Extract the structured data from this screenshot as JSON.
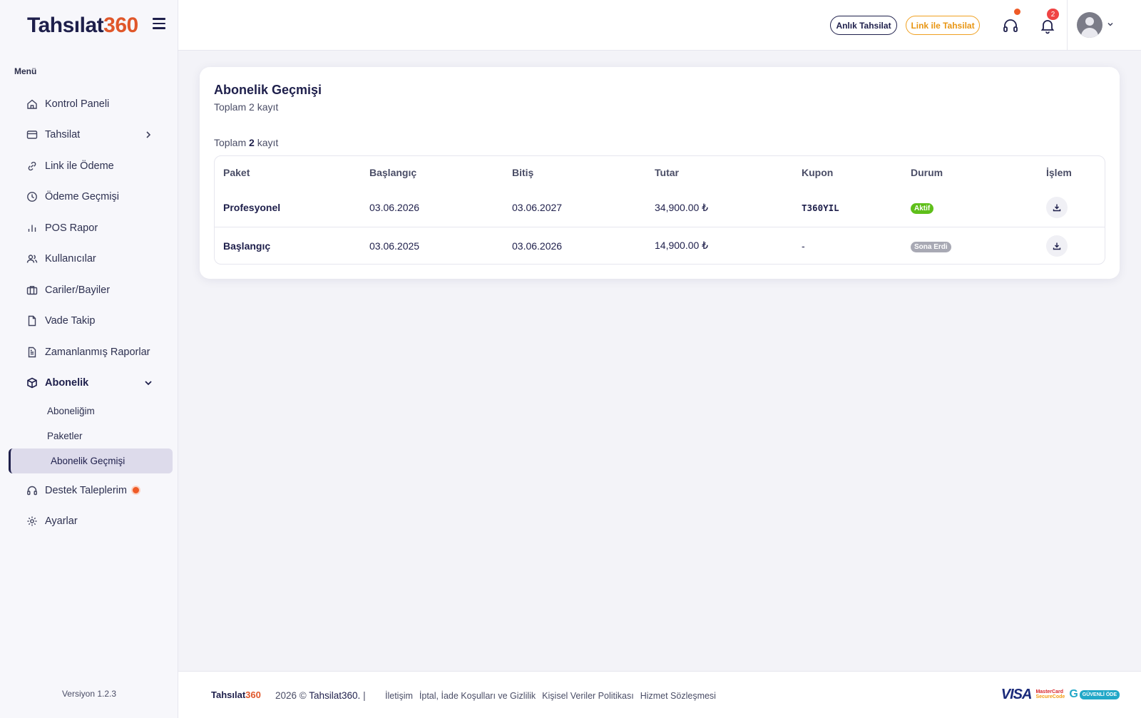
{
  "brand": {
    "logo_main": "Tahsılat",
    "logo_accent": "360"
  },
  "sidebar": {
    "menu_label": "Menü",
    "items": [
      {
        "label": "Kontrol Paneli",
        "icon": "home-icon"
      },
      {
        "label": "Tahsilat",
        "icon": "card-icon"
      },
      {
        "label": "Link ile Ödeme",
        "icon": "link-icon"
      },
      {
        "label": "Ödeme Geçmişi",
        "icon": "clock-icon"
      },
      {
        "label": "POS Rapor",
        "icon": "bar-chart-icon"
      },
      {
        "label": "Kullanıcılar",
        "icon": "users-icon"
      },
      {
        "label": "Cariler/Bayiler",
        "icon": "briefcase-icon"
      },
      {
        "label": "Vade Takip",
        "icon": "file-icon"
      },
      {
        "label": "Zamanlanmış Raporlar",
        "icon": "file-text-icon"
      },
      {
        "label": "Abonelik",
        "icon": "box-icon"
      }
    ],
    "subitems": [
      {
        "label": "Aboneliğim"
      },
      {
        "label": "Paketler"
      },
      {
        "label": "Abonelik Geçmişi"
      }
    ],
    "bottom_items": [
      {
        "label": "Destek Taleplerim",
        "icon": "headset-icon"
      },
      {
        "label": "Ayarlar",
        "icon": "gear-icon"
      }
    ],
    "version": "Versiyon 1.2.3"
  },
  "topbar": {
    "instant_button": "Anlık Tahsilat",
    "link_button": "Link ile Tahsilat",
    "notification_count": "2"
  },
  "card": {
    "title": "Abonelik Geçmişi",
    "subtitle": "Toplam 2 kayıt",
    "count_prefix": "Toplam",
    "count_value": "2",
    "count_suffix": "kayıt"
  },
  "table": {
    "headers": [
      "Paket",
      "Başlangıç",
      "Bitiş",
      "Tutar",
      "Kupon",
      "Durum",
      "İşlem"
    ],
    "rows": [
      {
        "paket": "Profesyonel",
        "baslangic": "03.06.2026",
        "bitis": "03.06.2027",
        "tutar": "34,900.00 ₺",
        "kupon": "T360YIL",
        "durum": "Aktif"
      },
      {
        "paket": "Başlangıç",
        "baslangic": "03.06.2025",
        "bitis": "03.06.2026",
        "tutar": "14,900.00 ₺",
        "kupon": "-",
        "durum": "Sona Erdi"
      }
    ]
  },
  "footer": {
    "logo_main": "Tahsılat",
    "logo_accent": "360",
    "copyright": "2026 ©",
    "brand": "Tahsilat360.",
    "separator": "|",
    "links": [
      "İletişim",
      "İptal, İade Koşulları ve Gizlilik",
      "Kişisel Veriler Politikası",
      "Hizmet Sözleşmesi"
    ],
    "visa": "VISA",
    "mc_line1": "MasterCard",
    "mc_line2": "SecureCode",
    "guvenli_g": "G",
    "guvenli_text": "GÜVENLİ ÖDE"
  },
  "colors": {
    "primary": "#1e1f4b",
    "accent": "#e0572a",
    "orange_button": "#f0a020",
    "active_pill": "#5fbf1a",
    "expired_pill": "#a8a9b4"
  }
}
